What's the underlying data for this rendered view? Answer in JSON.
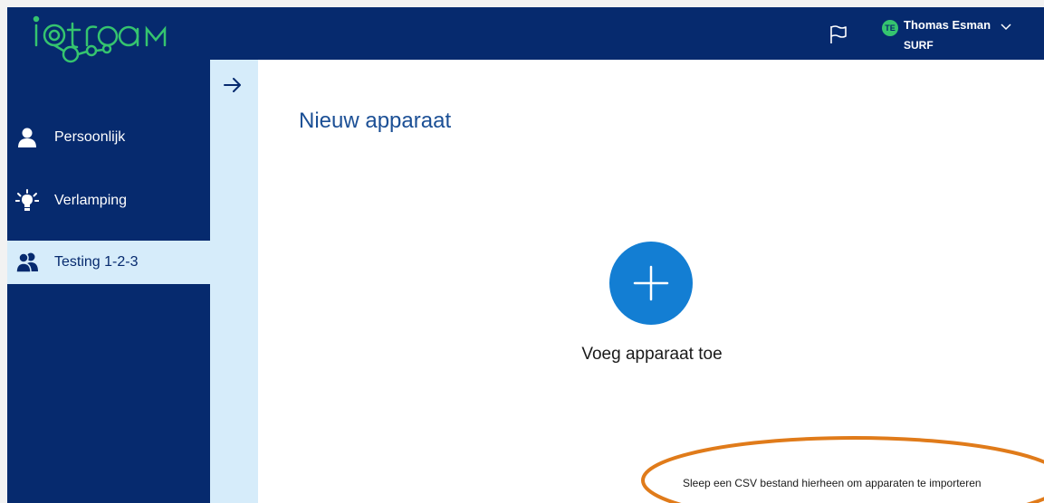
{
  "app": {
    "logo_text": "iotroam",
    "brand_color": "#062a6e",
    "accent_color": "#35c46f",
    "highlight_color": "#1b4f95"
  },
  "header": {
    "flag_icon": "flag-icon",
    "user": {
      "initials": "TE",
      "name": "Thomas Esman",
      "organization": "SURF",
      "chevron_icon": "chevron-down-icon"
    }
  },
  "sidebar": {
    "items": [
      {
        "label": "Persoonlijk",
        "icon": "person-icon",
        "active": false
      },
      {
        "label": "Verlamping",
        "icon": "lightbulb-icon",
        "active": false
      },
      {
        "label": "Testing 1-2-3",
        "icon": "group-icon",
        "active": true
      }
    ],
    "collapse_icon": "arrow-right-icon"
  },
  "main": {
    "title": "Nieuw apparaat",
    "add_button_icon": "plus-icon",
    "add_label": "Voeg apparaat toe",
    "csv_hint": "Sleep een CSV bestand hierheen om apparaten te importeren"
  },
  "annotation": {
    "shape": "ellipse",
    "color": "#e07b1a"
  }
}
